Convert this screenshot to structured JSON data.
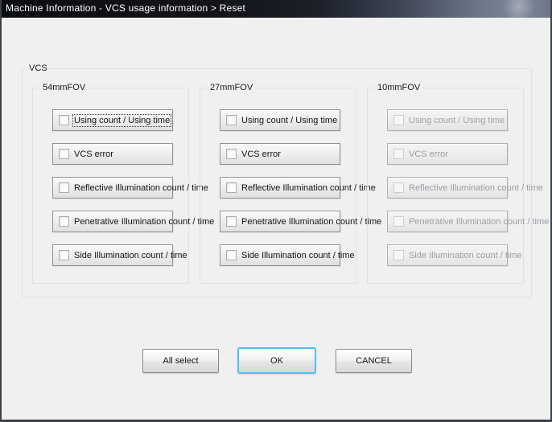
{
  "window": {
    "title": "Machine Information - VCS usage information > Reset"
  },
  "vcs_group": {
    "label": "VCS"
  },
  "columns": [
    {
      "label": "54mmFOV",
      "disabled": false,
      "focused_item_index": 0,
      "items": [
        {
          "label": "Using count / Using time",
          "checked": false
        },
        {
          "label": "VCS error",
          "checked": false
        },
        {
          "label": "Reflective Illumination count / time",
          "checked": false
        },
        {
          "label": "Penetrative Illumination count / time",
          "checked": false
        },
        {
          "label": "Side Illumination count / time",
          "checked": false
        }
      ]
    },
    {
      "label": "27mmFOV",
      "disabled": false,
      "focused_item_index": null,
      "items": [
        {
          "label": "Using count / Using time",
          "checked": false
        },
        {
          "label": "VCS error",
          "checked": false
        },
        {
          "label": "Reflective Illumination count / time",
          "checked": false
        },
        {
          "label": "Penetrative Illumination count / time",
          "checked": false
        },
        {
          "label": "Side Illumination count / time",
          "checked": false
        }
      ]
    },
    {
      "label": "10mmFOV",
      "disabled": true,
      "focused_item_index": null,
      "items": [
        {
          "label": "Using count / Using time",
          "checked": false
        },
        {
          "label": "VCS error",
          "checked": false
        },
        {
          "label": "Reflective Illumination count / time",
          "checked": false
        },
        {
          "label": "Penetrative Illumination count / time",
          "checked": false
        },
        {
          "label": "Side Illumination count / time",
          "checked": false
        }
      ]
    }
  ],
  "footer_buttons": {
    "all_select_label": "All select",
    "ok_label": "OK",
    "cancel_label": "CANCEL"
  },
  "colors": {
    "content_bg": "#f0f0f0",
    "titlebar_text": "#ffffff",
    "ok_focus_border": "#4cc3f2"
  }
}
